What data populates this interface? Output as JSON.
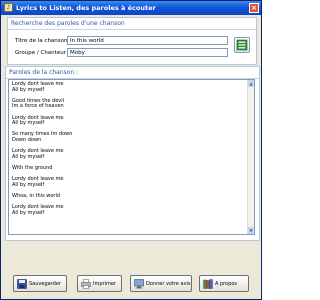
{
  "window": {
    "title": "Lyrics to Listen, des paroles à écouter",
    "title_icon": "book-icon",
    "close_icon": "close-icon"
  },
  "search": {
    "header": "Recherche des paroles d'une chanson",
    "song_label": "Titre de la chanson :",
    "song_value": "In this world",
    "artist_label": "Groupe / Chanteur :",
    "artist_value": "Moby",
    "search_icon": "search-results-icon"
  },
  "lyrics": {
    "header": "Paroles de la chanson :",
    "lines": [
      "Lordy dont leave me",
      "All by myself",
      "",
      "Good times the devil",
      "Im a force of heaven",
      "",
      "Lordy dont leave me",
      "All by myself",
      "",
      "So many times Im down",
      "Down down",
      "",
      "Lordy dont leave me",
      "All by myself",
      "",
      "With the ground",
      "",
      "Lordy dont leave me",
      "All by myself",
      "",
      "Whoa, in this world",
      "",
      "Lordy dont leave me",
      "All by myself"
    ]
  },
  "buttons": {
    "save": "Sauvegarder",
    "print": "Imprimer",
    "opinion": "Donner votre avis",
    "about": "A propos"
  },
  "colors": {
    "titlebar": "#1356d8",
    "header_text": "#2e5aa8"
  }
}
